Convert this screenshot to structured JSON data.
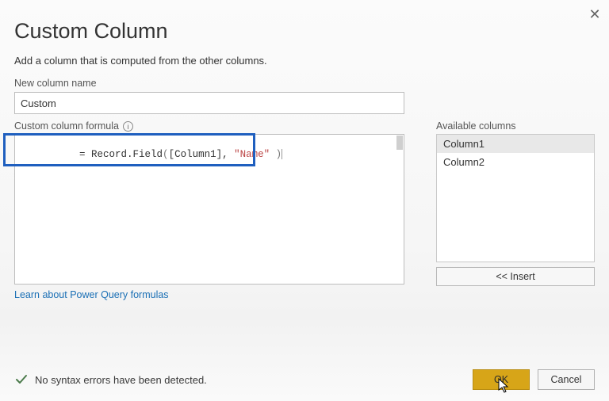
{
  "dialog": {
    "title": "Custom Column",
    "subtitle": "Add a column that is computed from the other columns.",
    "close_glyph": "✕"
  },
  "name_field": {
    "label": "New column name",
    "value": "Custom"
  },
  "formula": {
    "label": "Custom column formula",
    "info_glyph": "i",
    "prefix": "= ",
    "fn": "Record.Field",
    "open": "(",
    "col": "[Column1]",
    "comma": ", ",
    "str": "\"Name\"",
    "space": " ",
    "close": ")"
  },
  "available": {
    "label": "Available columns",
    "items": [
      "Column1",
      "Column2"
    ],
    "insert_label": "<< Insert"
  },
  "link": {
    "text": "Learn about Power Query formulas"
  },
  "status": {
    "text": "No syntax errors have been detected."
  },
  "buttons": {
    "ok": "OK",
    "cancel": "Cancel"
  }
}
